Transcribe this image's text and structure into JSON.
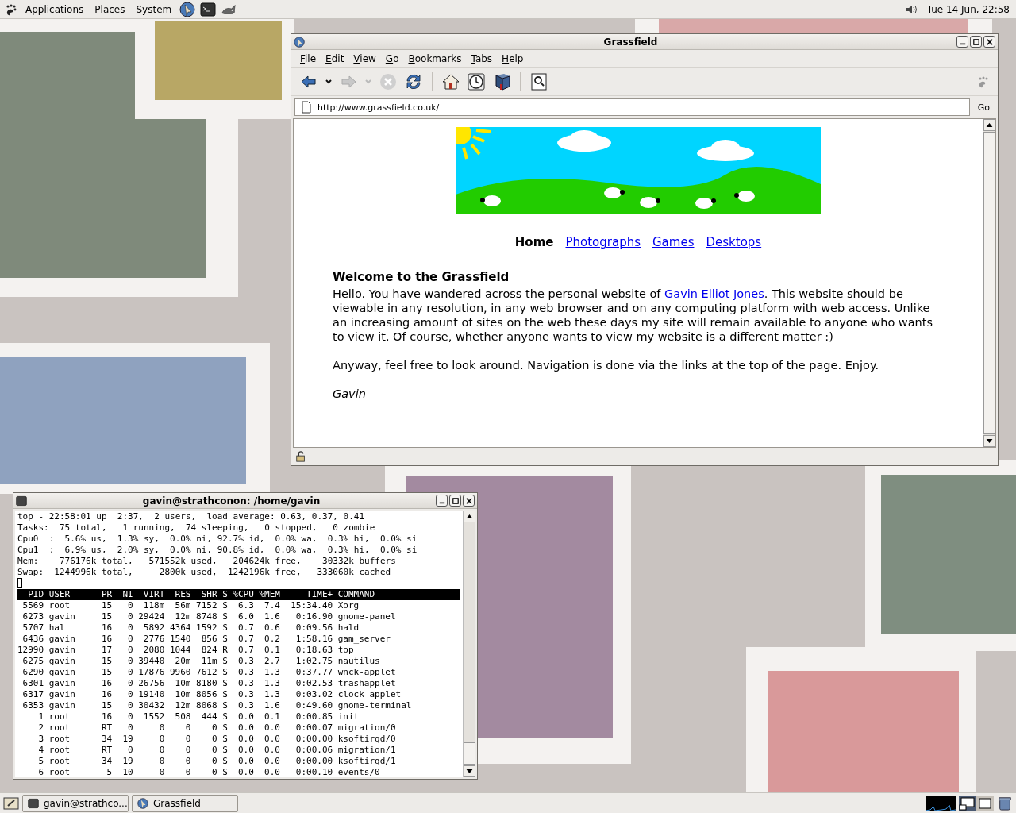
{
  "top_panel": {
    "menus": [
      "Applications",
      "Places",
      "System"
    ],
    "clock": "Tue 14 Jun, 22:58"
  },
  "browser": {
    "title": "Grassfield",
    "menu": [
      "File",
      "Edit",
      "View",
      "Go",
      "Bookmarks",
      "Tabs",
      "Help"
    ],
    "url": "http://www.grassfield.co.uk/",
    "go": "Go",
    "nav": [
      {
        "label": "Home",
        "selected": true
      },
      {
        "label": "Photographs",
        "selected": false
      },
      {
        "label": "Games",
        "selected": false
      },
      {
        "label": "Desktops",
        "selected": false
      }
    ],
    "heading": "Welcome to the Grassfield",
    "intro": {
      "before": "Hello. You have wandered across the personal website of ",
      "link": "Gavin Elliot Jones",
      "after": ". This website should be viewable in any resolution, in any web browser and on any computing platform with web access. Unlike an increasing amount of sites on the web these days my site will remain available to anyone who wants to view it. Of course, whether anyone wants to view my website is a different matter :)"
    },
    "paragraph": "Anyway, feel free to look around. Navigation is done via the links at the top of the page. Enjoy.",
    "signature": "Gavin"
  },
  "terminal": {
    "title": "gavin@strathconon: /home/gavin",
    "summary": [
      "top - 22:58:01 up  2:37,  2 users,  load average: 0.63, 0.37, 0.41",
      "Tasks:  75 total,   1 running,  74 sleeping,   0 stopped,   0 zombie",
      "Cpu0  :  5.6% us,  1.3% sy,  0.0% ni, 92.7% id,  0.0% wa,  0.3% hi,  0.0% si",
      "Cpu1  :  6.9% us,  2.0% sy,  0.0% ni, 90.8% id,  0.0% wa,  0.3% hi,  0.0% si",
      "Mem:    776176k total,   571552k used,   204624k free,    30332k buffers",
      "Swap:  1244996k total,     2800k used,  1242196k free,   333060k cached"
    ],
    "columns": [
      "PID",
      "USER",
      "PR",
      "NI",
      "VIRT",
      "RES",
      "SHR",
      "S",
      "%CPU",
      "%MEM",
      "TIME+",
      "COMMAND"
    ],
    "rows": [
      [
        "5569",
        "root",
        "15",
        "0",
        "118m",
        "56m",
        "7152",
        "S",
        "6.3",
        "7.4",
        "15:34.40",
        "Xorg"
      ],
      [
        "6273",
        "gavin",
        "15",
        "0",
        "29424",
        "12m",
        "8748",
        "S",
        "6.0",
        "1.6",
        "0:16.90",
        "gnome-panel"
      ],
      [
        "5707",
        "hal",
        "16",
        "0",
        "5892",
        "4364",
        "1592",
        "S",
        "0.7",
        "0.6",
        "0:09.56",
        "hald"
      ],
      [
        "6436",
        "gavin",
        "16",
        "0",
        "2776",
        "1540",
        "856",
        "S",
        "0.7",
        "0.2",
        "1:58.16",
        "gam_server"
      ],
      [
        "12990",
        "gavin",
        "17",
        "0",
        "2080",
        "1044",
        "824",
        "R",
        "0.7",
        "0.1",
        "0:18.63",
        "top"
      ],
      [
        "6275",
        "gavin",
        "15",
        "0",
        "39440",
        "20m",
        "11m",
        "S",
        "0.3",
        "2.7",
        "1:02.75",
        "nautilus"
      ],
      [
        "6290",
        "gavin",
        "15",
        "0",
        "17876",
        "9960",
        "7612",
        "S",
        "0.3",
        "1.3",
        "0:37.77",
        "wnck-applet"
      ],
      [
        "6301",
        "gavin",
        "16",
        "0",
        "26756",
        "10m",
        "8180",
        "S",
        "0.3",
        "1.3",
        "0:02.53",
        "trashapplet"
      ],
      [
        "6317",
        "gavin",
        "16",
        "0",
        "19140",
        "10m",
        "8056",
        "S",
        "0.3",
        "1.3",
        "0:03.02",
        "clock-applet"
      ],
      [
        "6353",
        "gavin",
        "15",
        "0",
        "30432",
        "12m",
        "8068",
        "S",
        "0.3",
        "1.6",
        "0:49.60",
        "gnome-terminal"
      ],
      [
        "1",
        "root",
        "16",
        "0",
        "1552",
        "508",
        "444",
        "S",
        "0.0",
        "0.1",
        "0:00.85",
        "init"
      ],
      [
        "2",
        "root",
        "RT",
        "0",
        "0",
        "0",
        "0",
        "S",
        "0.0",
        "0.0",
        "0:00.07",
        "migration/0"
      ],
      [
        "3",
        "root",
        "34",
        "19",
        "0",
        "0",
        "0",
        "S",
        "0.0",
        "0.0",
        "0:00.00",
        "ksoftirqd/0"
      ],
      [
        "4",
        "root",
        "RT",
        "0",
        "0",
        "0",
        "0",
        "S",
        "0.0",
        "0.0",
        "0:00.06",
        "migration/1"
      ],
      [
        "5",
        "root",
        "34",
        "19",
        "0",
        "0",
        "0",
        "S",
        "0.0",
        "0.0",
        "0:00.00",
        "ksoftirqd/1"
      ],
      [
        "6",
        "root",
        "5",
        "-10",
        "0",
        "0",
        "0",
        "S",
        "0.0",
        "0.0",
        "0:00.10",
        "events/0"
      ]
    ]
  },
  "taskbar": [
    {
      "label": "gavin@strathco...",
      "selected": false
    },
    {
      "label": "Grassfield",
      "selected": false
    }
  ]
}
